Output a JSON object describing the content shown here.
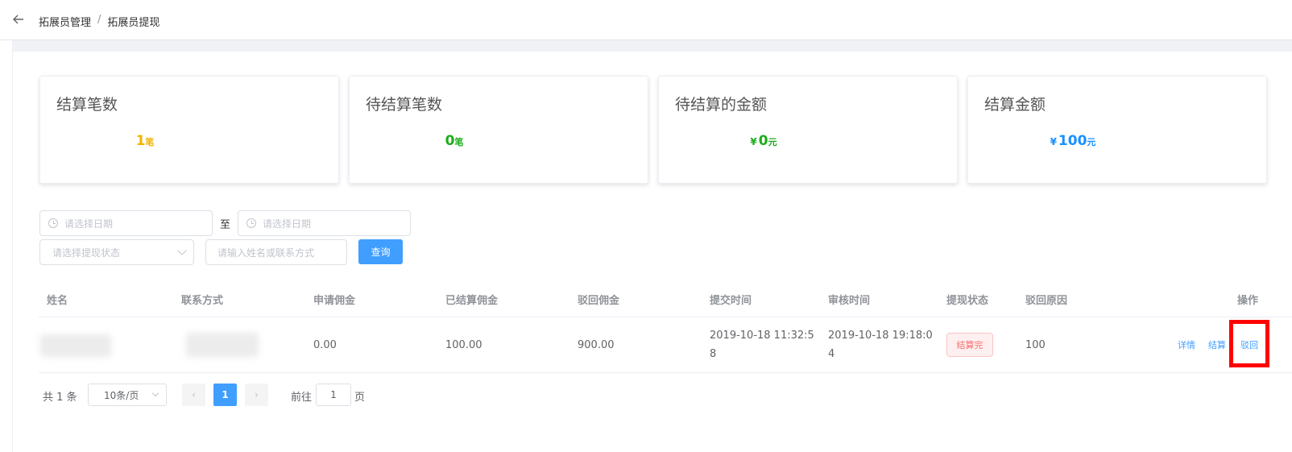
{
  "breadcrumb": {
    "items": [
      "拓展员管理",
      "拓展员提现"
    ],
    "separator": "/"
  },
  "stats": [
    {
      "title": "结算笔数",
      "currency": "",
      "value": "1",
      "unit": "笔",
      "color": "#f0b400"
    },
    {
      "title": "待结算笔数",
      "currency": "",
      "value": "0",
      "unit": "笔",
      "color": "#1aad19"
    },
    {
      "title": "待结算的金额",
      "currency": "¥",
      "value": "0",
      "unit": "元",
      "color": "#1aad19"
    },
    {
      "title": "结算金额",
      "currency": "¥",
      "value": "100",
      "unit": "元",
      "color": "#1890ff"
    }
  ],
  "filters": {
    "start_date_placeholder": "请选择日期",
    "to_label": "至",
    "end_date_placeholder": "请选择日期",
    "status_placeholder": "请选择提现状态",
    "search_placeholder": "请输入姓名或联系方式",
    "query_button": "查询"
  },
  "table": {
    "columns": [
      "姓名",
      "联系方式",
      "申请佣金",
      "已结算佣金",
      "驳回佣金",
      "提交时间",
      "审核时间",
      "提现状态",
      "驳回原因",
      "操作"
    ],
    "rows": [
      {
        "apply": "0.00",
        "settled": "100.00",
        "rejected": "900.00",
        "submit_time_line1": "2019-10-18 11:32:5",
        "submit_time_line2": "8",
        "review_time_line1": "2019-10-18 19:18:0",
        "review_time_line2": "4",
        "status": "结算完",
        "reason": "100",
        "actions": [
          "详情",
          "结算",
          "驳回"
        ]
      }
    ]
  },
  "pagination": {
    "total": "共 1 条",
    "page_size": "10条/页",
    "prev": "‹",
    "current": "1",
    "next": "›",
    "goto_label": "前往",
    "goto_value": "1",
    "page_label": "页"
  }
}
